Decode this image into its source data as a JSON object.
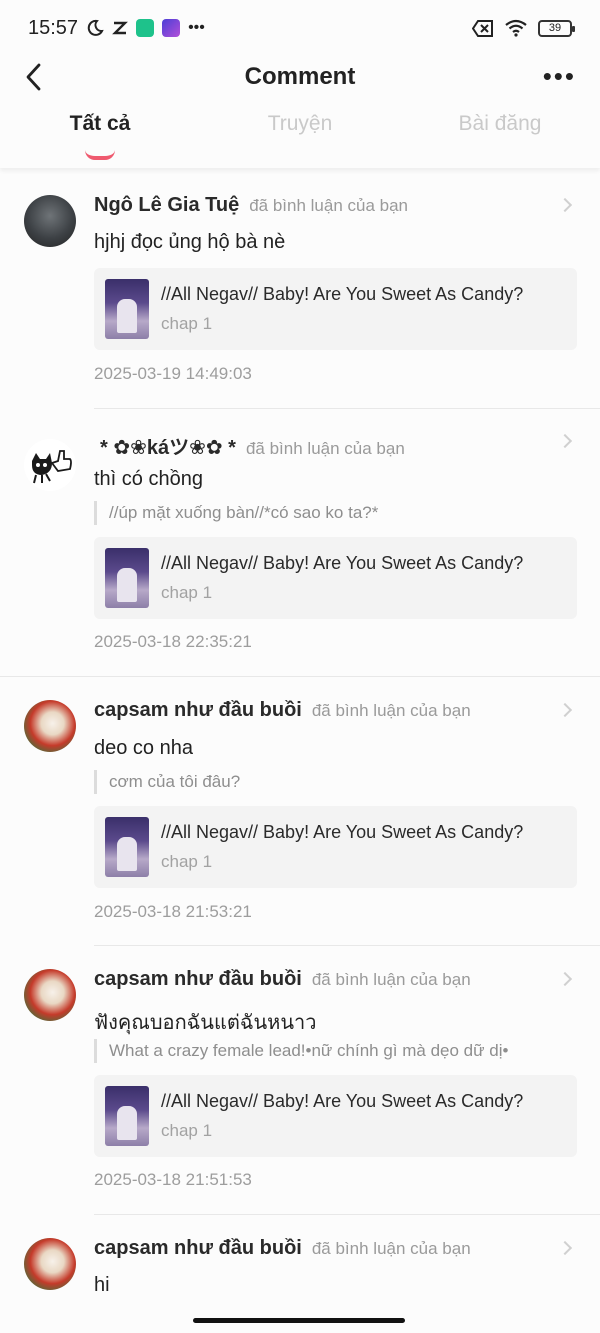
{
  "status_bar": {
    "time": "15:57",
    "battery": "39",
    "icons": [
      "moon-icon",
      "tiktok-icon",
      "app-green-icon",
      "app-purple-icon",
      "more-dots-icon",
      "sim-off-icon",
      "wifi-icon",
      "battery-icon"
    ]
  },
  "header": {
    "title": "Comment",
    "more": "•••"
  },
  "tabs": [
    {
      "label": "Tất cả",
      "active": true
    },
    {
      "label": "Truyện",
      "active": false
    },
    {
      "label": "Bài đăng",
      "active": false
    }
  ],
  "accent_color": "#ef5a6f",
  "comments": [
    {
      "user": "Ngô Lê Gia Tuệ",
      "action": "đã bình luận của bạn",
      "text": "hjhj đọc ủng hộ bà nè",
      "quote": null,
      "story_title": "//All Negav// Baby! Are You Sweet As Candy?",
      "chapter": "chap 1",
      "time": "2025-03-19 14:49:03"
    },
    {
      "user": "* ✿❀káツ❀✿ *",
      "action": "đã bình luận của bạn",
      "text": "thì có chồng",
      "quote": "//úp mặt xuống bàn//*có sao ko ta?*",
      "story_title": "//All Negav// Baby! Are You Sweet As Candy?",
      "chapter": "chap 1",
      "time": "2025-03-18 22:35:21"
    },
    {
      "user": "capsam như đầu buồi",
      "action": "đã bình luận của bạn",
      "text": "deo co nha",
      "quote": "cơm của tôi đâu?",
      "story_title": "//All Negav// Baby! Are You Sweet As Candy?",
      "chapter": "chap 1",
      "time": "2025-03-18 21:53:21"
    },
    {
      "user": "capsam như đầu buồi",
      "action": "đã bình luận của bạn",
      "text": "ฟังคุณบอกฉันแต่ฉันหนาว",
      "quote": "What a crazy female lead!•nữ chính gì mà dẹo dữ dị•",
      "story_title": "//All Negav// Baby! Are You Sweet As Candy?",
      "chapter": "chap 1",
      "time": "2025-03-18 21:51:53"
    },
    {
      "user": "capsam như đầu buồi",
      "action": "đã bình luận của bạn",
      "text": "hi"
    }
  ]
}
